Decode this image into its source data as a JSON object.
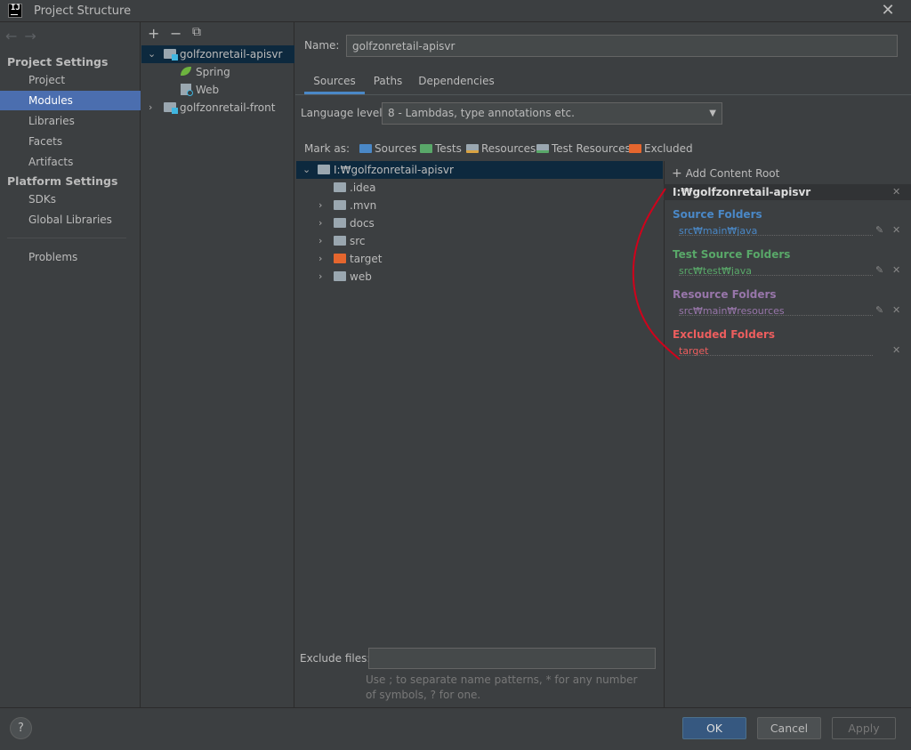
{
  "window": {
    "title": "Project Structure",
    "logo_text": "IJ"
  },
  "nav": {
    "project_settings_header": "Project Settings",
    "project_settings_items": [
      {
        "label": "Project",
        "selected": false
      },
      {
        "label": "Modules",
        "selected": true
      },
      {
        "label": "Libraries",
        "selected": false
      },
      {
        "label": "Facets",
        "selected": false
      },
      {
        "label": "Artifacts",
        "selected": false
      }
    ],
    "platform_settings_header": "Platform Settings",
    "platform_settings_items": [
      {
        "label": "SDKs"
      },
      {
        "label": "Global Libraries"
      }
    ],
    "problems_label": "Problems"
  },
  "module_tree": {
    "toolbar": {
      "add": "+",
      "remove": "−",
      "copy": "⧉"
    },
    "items": [
      {
        "label": "golfzonretail-apisvr",
        "expanded": true,
        "selected": true
      },
      {
        "label": "Spring",
        "type": "spring"
      },
      {
        "label": "Web",
        "type": "web"
      },
      {
        "label": "golfzonretail-front",
        "expanded": false
      }
    ]
  },
  "module": {
    "name_label": "Name:",
    "name_value": "golfzonretail-apisvr",
    "tabs": [
      {
        "label": "Sources",
        "active": true
      },
      {
        "label": "Paths",
        "active": false
      },
      {
        "label": "Dependencies",
        "active": false
      }
    ],
    "language_level_label": "Language level:",
    "language_level_value": "8 - Lambdas, type annotations etc.",
    "mark_as_label": "Mark as:",
    "mark_as": [
      {
        "label": "Sources",
        "color": "#4a88c7"
      },
      {
        "label": "Tests",
        "color": "#59a869"
      },
      {
        "label": "Resources",
        "color": "#9aa7b0"
      },
      {
        "label": "Test Resources",
        "color": "#9aa7b0"
      },
      {
        "label": "Excluded",
        "color": "#e5662e"
      }
    ]
  },
  "folder_tree": {
    "root": "I:₩golfzonretail-apisvr",
    "children": [
      {
        "label": ".idea",
        "expandable": false,
        "excluded": false
      },
      {
        "label": ".mvn",
        "expandable": true,
        "excluded": false
      },
      {
        "label": "docs",
        "expandable": true,
        "excluded": false
      },
      {
        "label": "src",
        "expandable": true,
        "excluded": false
      },
      {
        "label": "target",
        "expandable": true,
        "excluded": true
      },
      {
        "label": "web",
        "expandable": true,
        "excluded": false
      }
    ]
  },
  "content_roots": {
    "add_label": "Add Content Root",
    "root_path": "I:₩golfzonretail-apisvr",
    "groups": [
      {
        "title": "Source Folders",
        "path": "src₩main₩java",
        "color": "#4a88c7",
        "editable": true
      },
      {
        "title": "Test Source Folders",
        "path": "src₩test₩java",
        "color": "#59a869",
        "editable": true
      },
      {
        "title": "Resource Folders",
        "path": "src₩main₩resources",
        "color": "#9876aa",
        "editable": true
      },
      {
        "title": "Excluded Folders",
        "path": "target",
        "color": "#ed5e5e",
        "editable": false
      }
    ]
  },
  "exclude_files": {
    "label": "Exclude files:",
    "value": "",
    "hint": "Use ; to separate name patterns, * for any number of symbols, ? for one."
  },
  "buttons": {
    "help": "?",
    "ok": "OK",
    "cancel": "Cancel",
    "apply": "Apply"
  }
}
